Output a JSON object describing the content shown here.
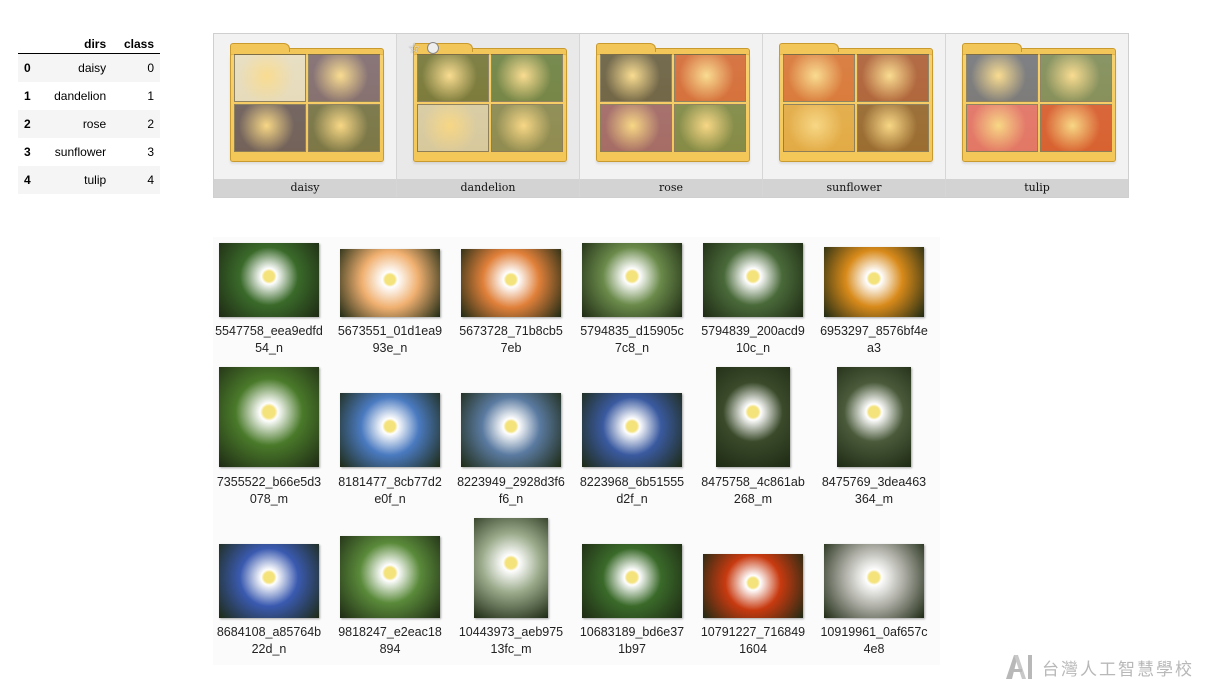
{
  "dataframe": {
    "columns": [
      "",
      "dirs",
      "class"
    ],
    "rows": [
      {
        "index": "0",
        "dirs": "daisy",
        "class": "0"
      },
      {
        "index": "1",
        "dirs": "dandelion",
        "class": "1"
      },
      {
        "index": "2",
        "dirs": "rose",
        "class": "2"
      },
      {
        "index": "3",
        "dirs": "sunflower",
        "class": "3"
      },
      {
        "index": "4",
        "dirs": "tulip",
        "class": "4"
      }
    ]
  },
  "folders": [
    {
      "name": "daisy",
      "colors": [
        "#dcdcdc",
        "#4a3a6a",
        "#2d2a58",
        "#3b4a3a"
      ]
    },
    {
      "name": "dandelion",
      "colors": [
        "#3a4a1a",
        "#2f5a2a",
        "#c8c8c0",
        "#5a6a4a"
      ]
    },
    {
      "name": "rose",
      "colors": [
        "#2a2a2a",
        "#c23a1a",
        "#7a3a6a",
        "#4a6a3a"
      ]
    },
    {
      "name": "sunflower",
      "colors": [
        "#c84a1a",
        "#8a2a1a",
        "#d89a3a",
        "#6a3a1a"
      ]
    },
    {
      "name": "tulip",
      "colors": [
        "#3a4a7a",
        "#4a6a4a",
        "#d84a6a",
        "#c82a1a"
      ]
    }
  ],
  "grid": {
    "items": [
      {
        "name": "5547758_eea9edfd54_n",
        "color": "#3a6a2a"
      },
      {
        "name": "5673551_01d1ea993e_n",
        "color": "#f0b070"
      },
      {
        "name": "5673728_71b8cb57eb",
        "color": "#e0803a"
      },
      {
        "name": "5794835_d15905c7c8_n",
        "color": "#6a8a4a"
      },
      {
        "name": "5794839_200acd910c_n",
        "color": "#4a6a3a"
      },
      {
        "name": "6953297_8576bf4ea3",
        "color": "#d88a1a"
      },
      {
        "name": "7355522_b66e5d3078_m",
        "color": "#4a7a2a"
      },
      {
        "name": "8181477_8cb77d2e0f_n",
        "color": "#4a7ac0"
      },
      {
        "name": "8223949_2928d3f6f6_n",
        "color": "#5a7aa0"
      },
      {
        "name": "8223968_6b51555d2f_n",
        "color": "#3a5aa0"
      },
      {
        "name": "8475758_4c861ab268_m",
        "color": "#3a4a2a"
      },
      {
        "name": "8475769_3dea463364_m",
        "color": "#4a5a3a"
      },
      {
        "name": "8684108_a85764b22d_n",
        "color": "#3a5ab0"
      },
      {
        "name": "9818247_e2eac18894",
        "color": "#5a8a3a"
      },
      {
        "name": "10443973_aeb97513fc_m",
        "color": "#9aaa8a"
      },
      {
        "name": "10683189_bd6e371b97",
        "color": "#3a6a2a"
      },
      {
        "name": "10791227_7168491604",
        "color": "#c83a10"
      },
      {
        "name": "10919961_0af657c4e8",
        "color": "#b0b0a8"
      }
    ]
  },
  "watermark": {
    "text": "台灣人工智慧學校"
  }
}
